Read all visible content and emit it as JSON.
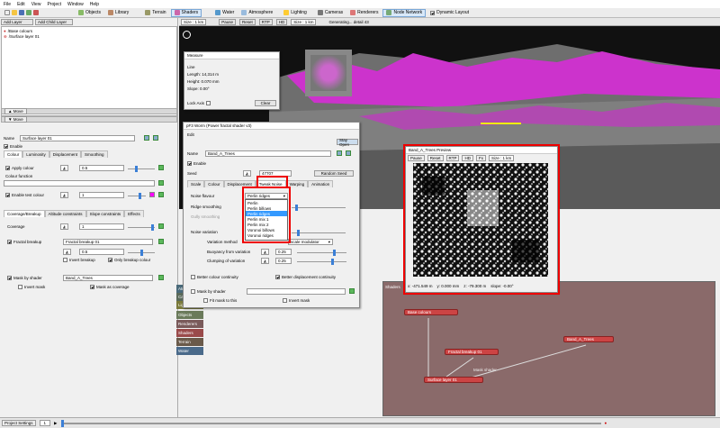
{
  "menu": [
    "File",
    "Edit",
    "View",
    "Project",
    "Window",
    "Help"
  ],
  "toolbar": {
    "items": [
      {
        "label": "Objects",
        "icon": "cube-icon"
      },
      {
        "label": "Library",
        "icon": "book-icon"
      },
      {
        "label": "Terrain",
        "icon": "mountain-icon"
      },
      {
        "label": "Shaders",
        "icon": "palette-icon"
      },
      {
        "label": "Water",
        "icon": "wave-icon"
      },
      {
        "label": "Atmosphere",
        "icon": "cloud-icon"
      },
      {
        "label": "Lighting",
        "icon": "sun-icon"
      },
      {
        "label": "Cameras",
        "icon": "camera-icon"
      },
      {
        "label": "Renderers",
        "icon": "render-icon"
      },
      {
        "label": "Node Network",
        "icon": "network-icon"
      }
    ],
    "dynamic_layout_label": "Dynamic Layout"
  },
  "left": {
    "add_layer": "Add Layer",
    "add_child_layer": "Add Child Layer",
    "size_label": "Size : 1 km",
    "tree_items": [
      "/Base colours",
      "/Surface layer 01"
    ],
    "move1": "Move",
    "move2": "Move",
    "name_label": "Name",
    "name_value": "Surface layer 01",
    "enable_label": "Enable",
    "tabs": [
      "Colour",
      "Luminosity",
      "Displacement",
      "Smoothing"
    ],
    "apply_colour_label": "Apply colour",
    "apply_colour_value": "0.5",
    "colour_function_label": "Colour function",
    "enable_test_colour_label": "Enable test colour",
    "test_colour_value": "1",
    "tabs2": [
      "Coverage/Breakup",
      "Altitude constraints",
      "Slope constraints",
      "Effects"
    ],
    "coverage_label": "Coverage",
    "coverage_value": "1",
    "fractal_breakup_label": "Fractal breakup",
    "fractal_breakup_value": "Fractal breakup 01",
    "fractal_amount": "0.5",
    "invert_breakup_label": "Invert breakup",
    "only_breakup_colour_label": "Only breakup colour",
    "mask_by_shader_label": "Mask by shader",
    "mask_by_shader_value": "Band_A_Trees",
    "invert_mask_label": "Invert mask",
    "mask_as_coverage_label": "Mask as coverage"
  },
  "viewport": {
    "pause": "Pause",
    "reset": "Reset",
    "rtp": "RTP",
    "hd": "HD",
    "size": "Size : 1 km",
    "status": "Generating... detail 43"
  },
  "measure": {
    "title": "Measure",
    "line_label": "Line",
    "length": "Length: 14,314 m",
    "height": "Height: 0.070 mm",
    "slope": "Slope: 0.00°",
    "lock_axis": "Lock Axis",
    "clear": "Clear"
  },
  "pfw": {
    "title": "pF3 Worm   (Power fractal shader v3)",
    "edit": "Edit",
    "name_label": "Name",
    "name_value": "Band_A_Trees",
    "enable_label": "Enable",
    "stay_open": "Stay Open",
    "seed_label": "Seed",
    "seed_value": "47707",
    "random_seed": "Random Seed",
    "tabs": [
      "Scale",
      "Colour",
      "Displacement",
      "Tweak Noise",
      "Warping",
      "Animation"
    ],
    "noise_flavour_label": "Noise flavour",
    "noise_flavour_value": "Perlin ridges",
    "ridge_smoothing_label": "Ridge smoothing",
    "gully_smoothing_label": "Gully smoothing",
    "noise_variation_label": "Noise variation",
    "variation_method_label": "Variation method",
    "variation_method_value": "scale modulator",
    "buoyancy_label": "Buoyancy from variation",
    "buoyancy_value": "0.25",
    "clumping_label": "Clumping of variation",
    "clumping_value": "0.25",
    "better_colour_label": "Better colour continuity",
    "better_disp_label": "Better displacement continuity",
    "mask_by_shader_label": "Mask by shader",
    "fit_mask_label": "Fit mask to this",
    "invert_mask_label": "Invert mask",
    "dropdown_options": [
      "Perlin",
      "Perlin billows",
      "Perlin ridges",
      "Perlin mix 1",
      "Perlin mix 2",
      "Voronoi billows",
      "Voronoi ridges"
    ],
    "dropdown_selected": 2
  },
  "preview": {
    "title": "Band_A_Trees Preview",
    "pause": "Pause",
    "reset": "Reset",
    "rtp": "RTP",
    "hd": "HD",
    "fx": "Fx",
    "size": "Size : 1 km",
    "x": "x: -471.549 m",
    "y": "y: 0.000 mm",
    "z": "z: -79.300 m",
    "slope": "slope: -0.00°"
  },
  "layers": [
    "Atmosphere",
    "Cameras",
    "Lighting",
    "Objects",
    "Renderers",
    "Shaders",
    "Terrain",
    "Water"
  ],
  "node_view": {
    "label": "Shaders",
    "nodes": {
      "base_colours": "Base colours",
      "band_a_trees": "Band_A_Trees",
      "fractal_breakup": "Fractal breakup 01",
      "surface_layer": "Surface layer 01"
    },
    "edge_label": "Mask shader"
  },
  "status": {
    "project_settings": "Project Settings",
    "frame": "1"
  },
  "colors": {
    "accent": "#3b7fd6",
    "highlight_red": "#e00000",
    "node_red": "#c44444",
    "magenta": "#ff00ff"
  }
}
